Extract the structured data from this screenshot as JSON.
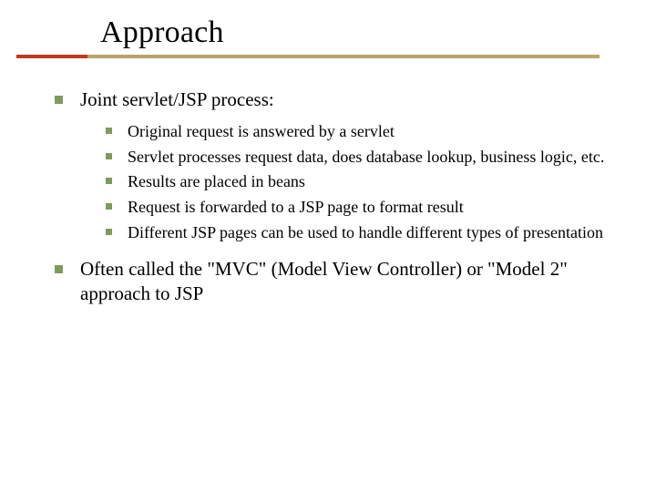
{
  "title": "Approach",
  "points": [
    {
      "text": "Joint servlet/JSP process:",
      "sub": [
        "Original request is answered by a servlet",
        "Servlet processes request data, does database lookup, business logic, etc.",
        "Results are placed in beans",
        "Request is forwarded to a JSP page to format result",
        "Different JSP pages can be used to handle different types of presentation"
      ]
    },
    {
      "text": "Often called the \"MVC\" (Model View Controller) or \"Model 2\" approach to JSP",
      "sub": []
    }
  ]
}
